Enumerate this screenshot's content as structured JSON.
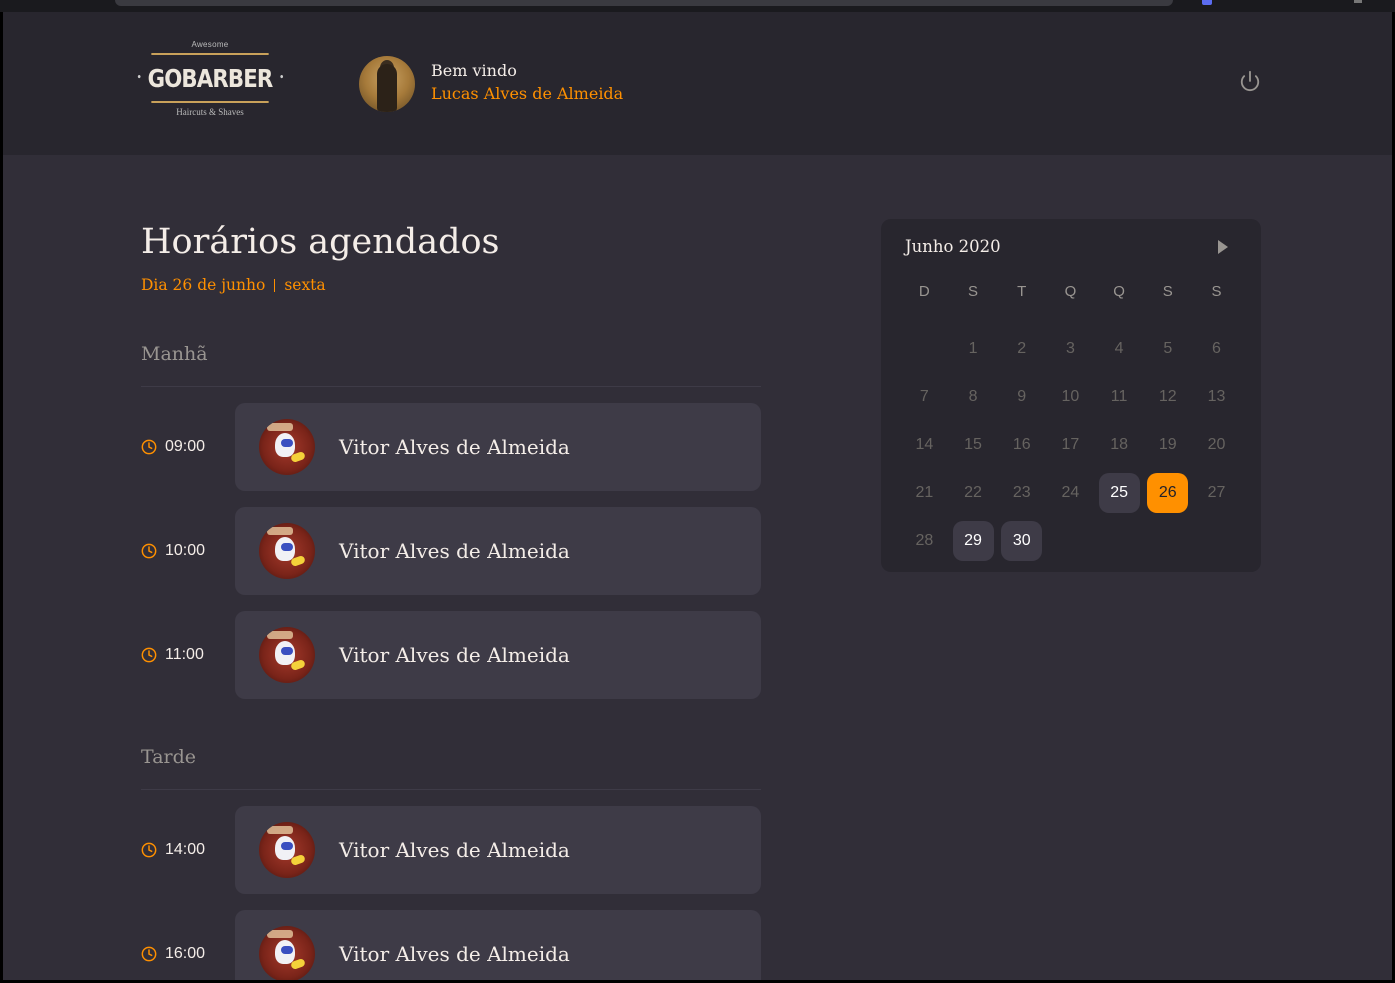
{
  "header": {
    "logo": {
      "top": "Awesome",
      "main": "GOBARBER",
      "sub": "Haircuts & Shaves"
    },
    "welcome": "Bem vindo",
    "user_name": "Lucas Alves de Almeida"
  },
  "schedule": {
    "title": "Horários agendados",
    "date": "Dia 26 de junho",
    "weekday": "sexta",
    "morning": {
      "label": "Manhã",
      "items": [
        {
          "time": "09:00",
          "name": "Vitor Alves de Almeida"
        },
        {
          "time": "10:00",
          "name": "Vitor Alves de Almeida"
        },
        {
          "time": "11:00",
          "name": "Vitor Alves de Almeida"
        }
      ]
    },
    "afternoon": {
      "label": "Tarde",
      "items": [
        {
          "time": "14:00",
          "name": "Vitor Alves de Almeida"
        },
        {
          "time": "16:00",
          "name": "Vitor Alves de Almeida"
        }
      ]
    }
  },
  "calendar": {
    "month_label": "Junho 2020",
    "weekdays": [
      "D",
      "S",
      "T",
      "Q",
      "Q",
      "S",
      "S"
    ],
    "start_offset": 1,
    "days": [
      1,
      2,
      3,
      4,
      5,
      6,
      7,
      8,
      9,
      10,
      11,
      12,
      13,
      14,
      15,
      16,
      17,
      18,
      19,
      20,
      21,
      22,
      23,
      24,
      25,
      26,
      27,
      28,
      29,
      30
    ],
    "available": [
      25,
      29,
      30
    ],
    "selected": 26
  },
  "colors": {
    "accent": "#ff9000",
    "background": "#312e38",
    "header": "#28262e",
    "card": "#3e3b47"
  }
}
